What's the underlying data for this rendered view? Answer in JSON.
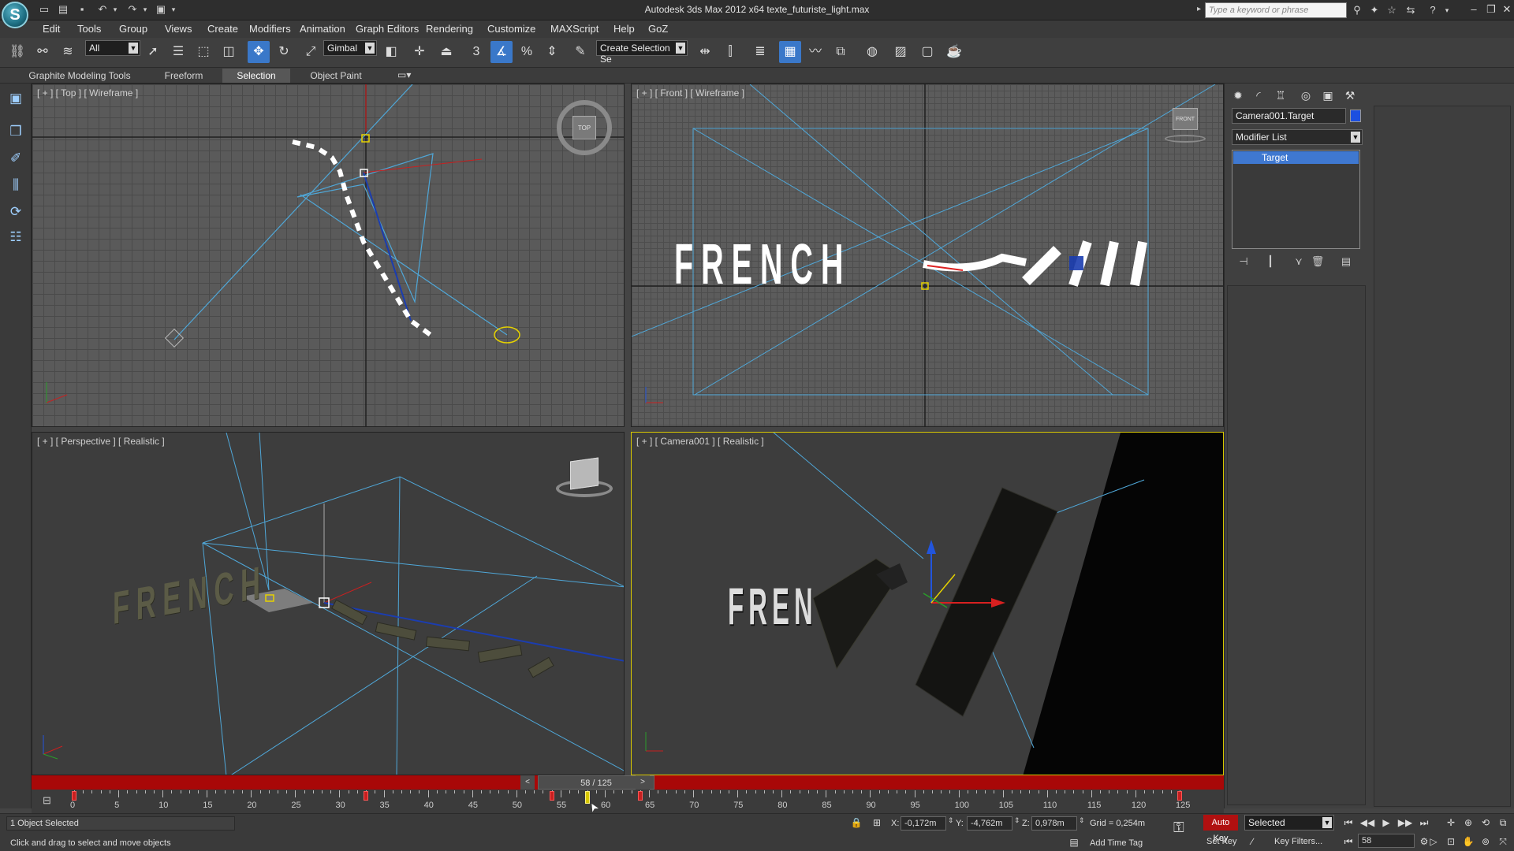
{
  "app": {
    "logo_letter": "S",
    "title": "Autodesk 3ds Max  2012 x64      texte_futuriste_light.max",
    "search_placeholder": "Type a keyword or phrase"
  },
  "menu": [
    "Edit",
    "Tools",
    "Group",
    "Views",
    "Create",
    "Modifiers",
    "Animation",
    "Graph Editors",
    "Rendering",
    "Customize",
    "MAXScript",
    "Help",
    "GoZ"
  ],
  "toolbar": {
    "selection_filter": "All",
    "reference_coord": "Gimbal",
    "named_selection": "Create Selection Se",
    "snap_3": "3",
    "percent_snap": "%"
  },
  "ribbon": {
    "tabs": [
      "Graphite Modeling Tools",
      "Freeform",
      "Selection",
      "Object Paint"
    ],
    "active_tab": "Selection"
  },
  "viewports": {
    "top": {
      "label": "[ + ] [ Top ] [ Wireframe ]",
      "cube": "TOP"
    },
    "front": {
      "label": "[ + ] [ Front ] [ Wireframe ]",
      "cube": "FRONT",
      "text": "FRENCH"
    },
    "perspective": {
      "label": "[ + ] [ Perspective ] [ Realistic ]",
      "text": "FRENCH"
    },
    "camera": {
      "label": "[ + ] [ Camera001 ] [ Realistic ]",
      "text": "FREN"
    }
  },
  "command_panel": {
    "object_name": "Camera001.Target",
    "object_color": "#1c4fe0",
    "modifier_list": "Modifier List",
    "stack_items": [
      "Target"
    ]
  },
  "timeline": {
    "thumb_label": "58 / 125",
    "current_frame": 58,
    "total_frames": 125,
    "ticks": [
      0,
      5,
      10,
      15,
      20,
      25,
      30,
      35,
      40,
      45,
      50,
      55,
      60,
      65,
      70,
      75,
      80,
      85,
      90,
      95,
      100,
      105,
      110,
      115,
      120,
      125
    ],
    "keys": [
      0,
      33,
      54,
      64,
      125
    ]
  },
  "status": {
    "selection_info": "1 Object Selected",
    "prompt": "Click and drag to select and move objects",
    "x_label": "X:",
    "x_value": "-0,172m",
    "y_label": "Y:",
    "y_value": "-4,762m",
    "z_label": "Z:",
    "z_value": "0,978m",
    "grid": "Grid = 0,254m",
    "add_time_tag": "Add Time Tag",
    "auto_key": "Auto Key",
    "set_key": "Set Key",
    "key_mode": "Selected",
    "key_filters": "Key Filters...",
    "frame_field": "58"
  }
}
